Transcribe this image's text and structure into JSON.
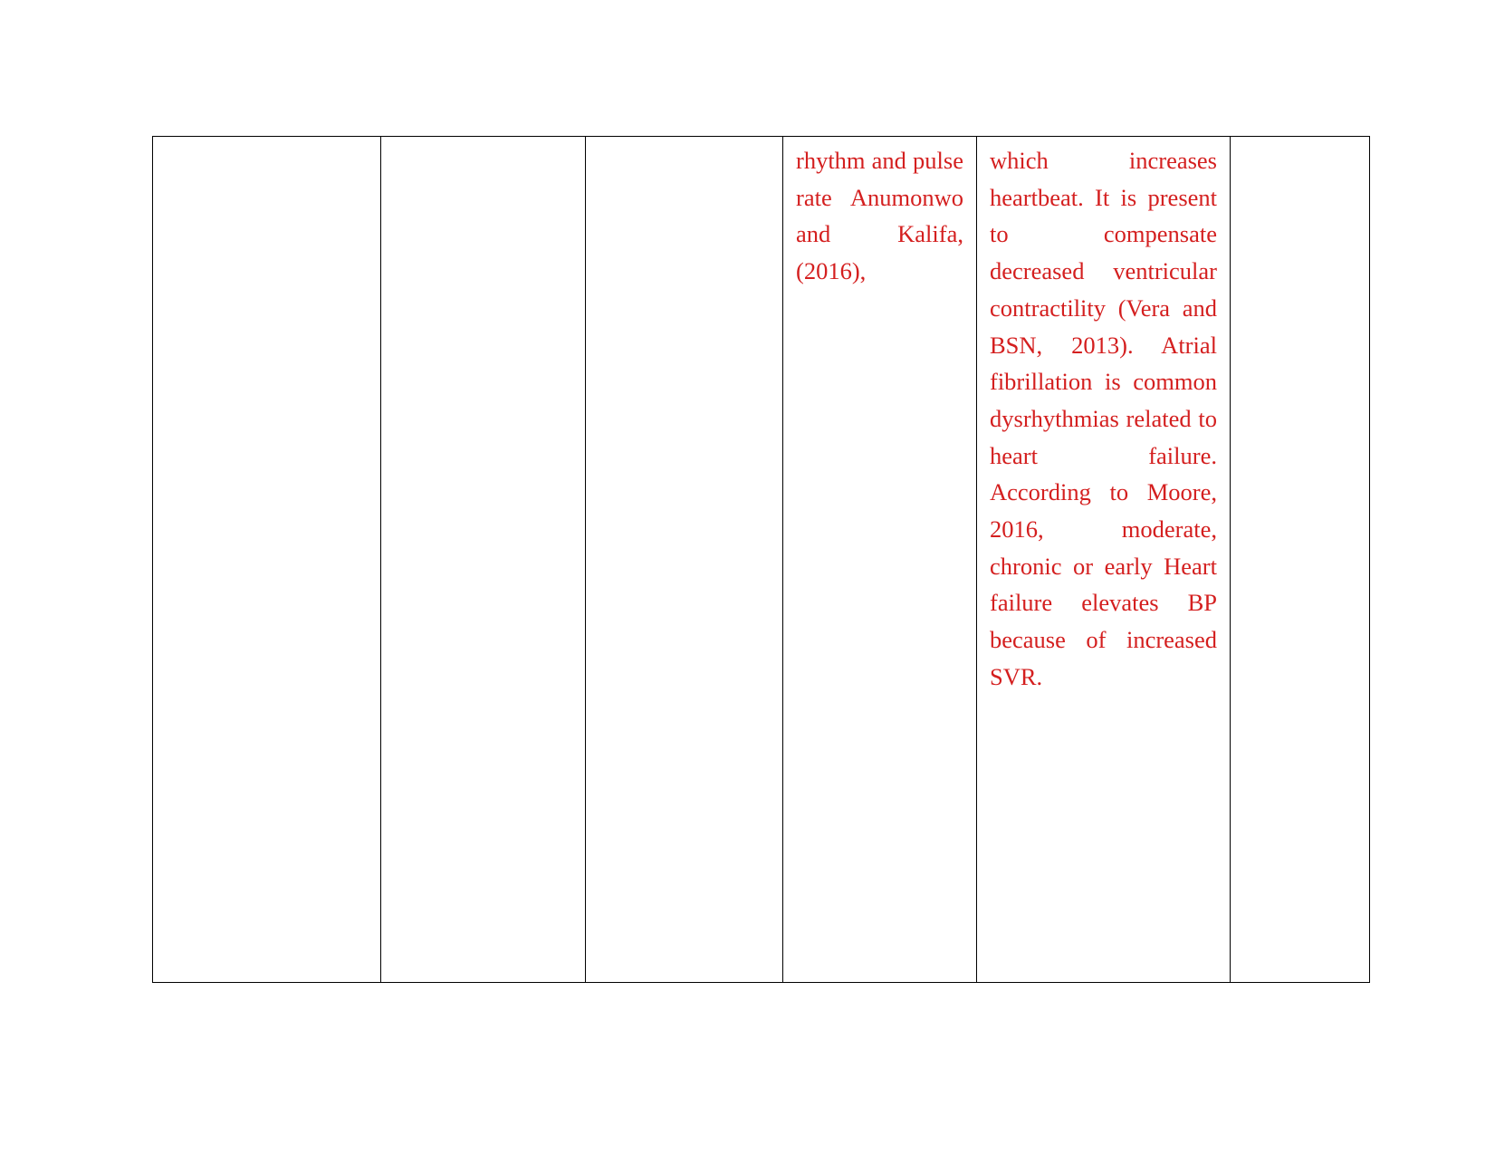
{
  "document": {
    "page_background": "#ffffff",
    "text_color": "#D41F1F",
    "border_color": "#000000",
    "table": {
      "columns": 6,
      "rows": 1,
      "cells": [
        {
          "id": "cell-c1",
          "column": 1,
          "text": ""
        },
        {
          "id": "cell-c2",
          "column": 2,
          "text": ""
        },
        {
          "id": "cell-c3",
          "column": 3,
          "text": ""
        },
        {
          "id": "cell-c4",
          "column": 4,
          "text": "rhythm and pulse rate Anumonwo and Kalifa, (2016),"
        },
        {
          "id": "cell-c5",
          "column": 5,
          "text": "which increases heartbeat. It is present to compensate decreased ventricular contractility (Vera and BSN, 2013). Atrial fibrillation is common dysrhythmias related to heart failure. According to Moore, 2016, moderate, chronic or early Heart failure elevates BP because of increased SVR."
        },
        {
          "id": "cell-c6",
          "column": 6,
          "text": ""
        }
      ]
    }
  }
}
